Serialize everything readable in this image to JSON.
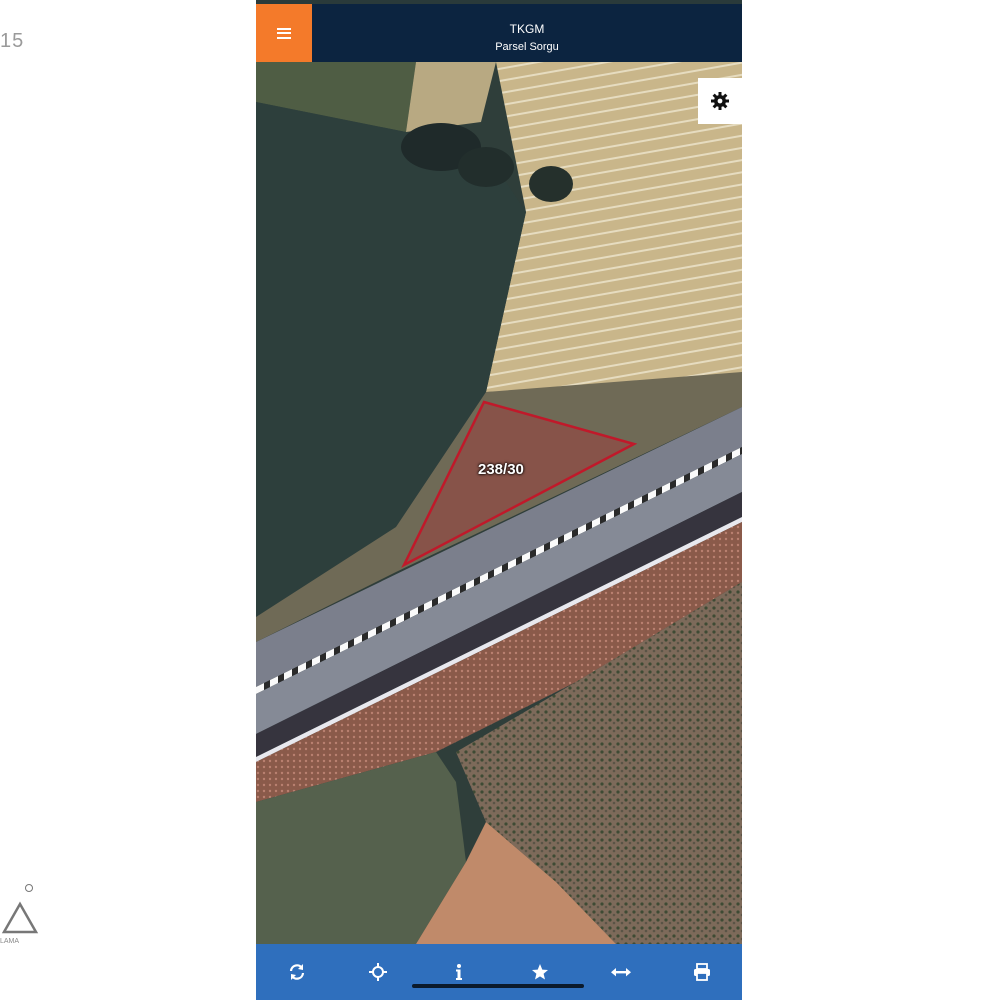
{
  "side": {
    "page_number": "15",
    "logo_text": "LAMA"
  },
  "header": {
    "title": "TKGM",
    "subtitle": "Parsel Sorgu",
    "menu_icon": "hamburger-menu-icon"
  },
  "settings": {
    "icon": "gear-icon"
  },
  "parcel": {
    "label": "238/30",
    "outline_color": "#c0192a"
  },
  "toolbar": {
    "items": [
      {
        "icon": "refresh-icon"
      },
      {
        "icon": "crosshair-icon"
      },
      {
        "icon": "info-icon"
      },
      {
        "icon": "star-icon"
      },
      {
        "icon": "measure-icon"
      },
      {
        "icon": "print-icon"
      }
    ]
  },
  "colors": {
    "header_bg": "#0c2440",
    "menu_accent": "#f47a2a",
    "toolbar_bg": "#2f6fbd"
  }
}
